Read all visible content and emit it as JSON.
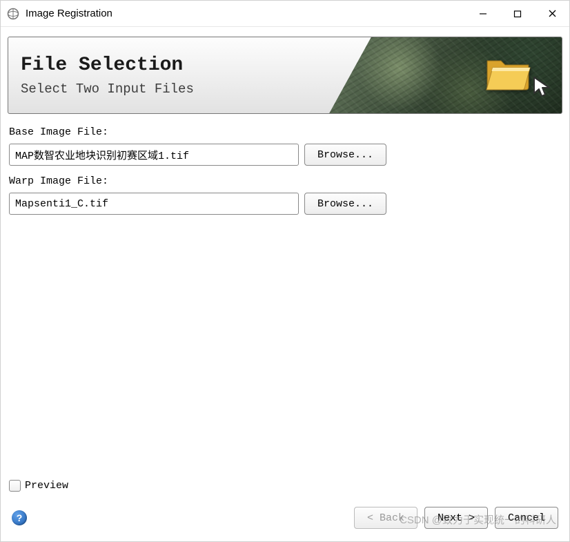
{
  "window": {
    "title": "Image Registration"
  },
  "banner": {
    "title": "File Selection",
    "subtitle": "Select Two Input Files"
  },
  "fields": {
    "base_label": "Base Image File:",
    "base_value": "MAP数智农业地块识别初赛区域1.tif",
    "base_browse": "Browse...",
    "warp_label": "Warp Image File:",
    "warp_value": "Mapsenti1_C.tif",
    "warp_browse": "Browse..."
  },
  "preview": {
    "label": "Preview",
    "checked": false
  },
  "buttons": {
    "back": "< Back",
    "next": "Next >",
    "cancel": "Cancel"
  },
  "help_symbol": "?",
  "watermark": "CSDN @致力于实现统一的科研人"
}
